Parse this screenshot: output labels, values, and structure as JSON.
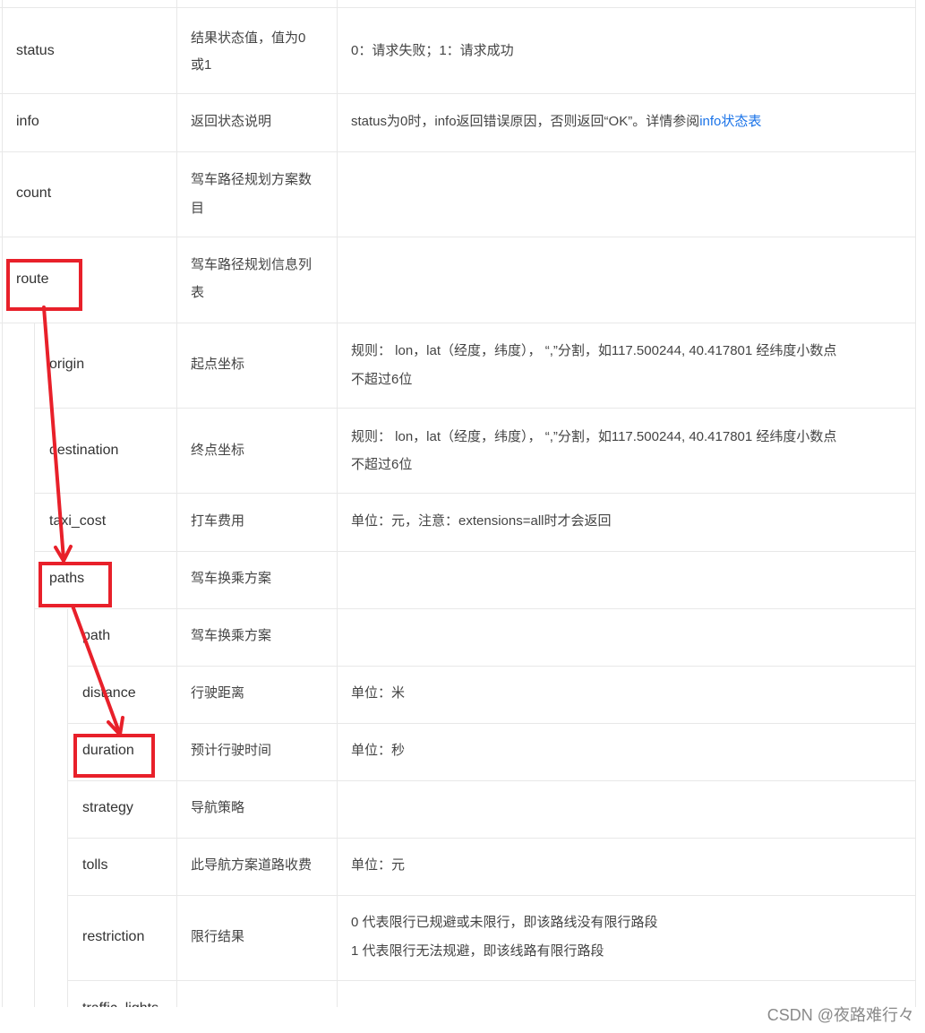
{
  "rows": {
    "status": {
      "name": "status",
      "type": "结果状态值，值为0",
      "type2": "或1",
      "desc": "0：请求失败；1：请求成功"
    },
    "info": {
      "name": "info",
      "type": "返回状态说明",
      "desc_a": "status为0时，info返回错误原因，否则返回“OK”。详情参阅",
      "desc_link": "info状态表"
    },
    "count": {
      "name": "count",
      "type": "驾车路径规划方案数",
      "type2": "目"
    },
    "route": {
      "name": "route",
      "type": "驾车路径规划信息列",
      "type2": "表"
    },
    "origin": {
      "name": "origin",
      "type": "起点坐标",
      "desc": "规则： lon，lat（经度，纬度）， “,”分割，如117.500244, 40.417801 经纬度小数点",
      "desc2": "不超过6位"
    },
    "destination": {
      "name": "destination",
      "type": "终点坐标",
      "desc": "规则： lon，lat（经度，纬度）， “,”分割，如117.500244, 40.417801 经纬度小数点",
      "desc2": "不超过6位"
    },
    "taxi_cost": {
      "name": "taxi_cost",
      "type": "打车费用",
      "desc": "单位：元，注意：extensions=all时才会返回"
    },
    "paths": {
      "name": "paths",
      "type": "驾车换乘方案"
    },
    "path": {
      "name": "path",
      "type": "驾车换乘方案"
    },
    "distance": {
      "name": "distance",
      "type": "行驶距离",
      "desc": "单位：米"
    },
    "duration": {
      "name": "duration",
      "type": "预计行驶时间",
      "desc": "单位：秒"
    },
    "strategy": {
      "name": "strategy",
      "type": "导航策略"
    },
    "tolls": {
      "name": "tolls",
      "type": "此导航方案道路收费",
      "desc": "单位：元"
    },
    "restriction": {
      "name": "restriction",
      "type": "限行结果",
      "desc": "0 代表限行已规避或未限行，即该路线没有限行路段",
      "desc2": "1 代表限行无法规避，即该线路有限行路段"
    },
    "traffic_lights": {
      "name": "traffic_lights"
    }
  },
  "watermark": "CSDN @夜路难行々",
  "colors": {
    "annotation": "#e8202a",
    "link": "#1a73e8",
    "border": "#e8e8e8"
  }
}
